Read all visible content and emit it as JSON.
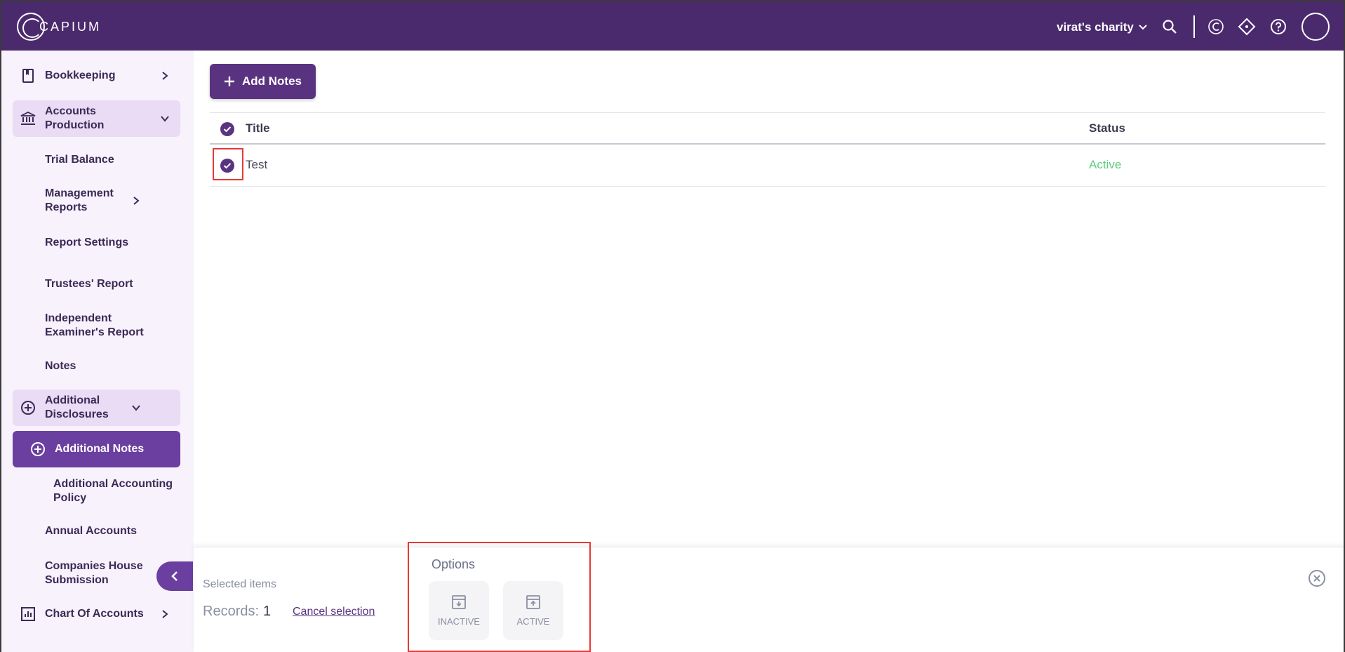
{
  "header": {
    "logo_text": "CAPIUM",
    "org_name": "virat's charity"
  },
  "sidebar": {
    "items": [
      {
        "label": "Bookkeeping",
        "icon": "book-icon"
      },
      {
        "label": "Accounts Production",
        "icon": "bank-icon"
      },
      {
        "label": "Trial Balance"
      },
      {
        "label": "Management Reports"
      },
      {
        "label": "Report Settings"
      },
      {
        "label": "Trustees' Report"
      },
      {
        "label": "Independent Examiner's Report"
      },
      {
        "label": "Notes"
      },
      {
        "label": "Additional Disclosures",
        "icon": "add-circle-icon"
      },
      {
        "label": "Additional Notes",
        "icon": "add-circle-icon"
      },
      {
        "label": "Additional Accounting Policy"
      },
      {
        "label": "Annual Accounts"
      },
      {
        "label": "Companies House Submission"
      },
      {
        "label": "Chart Of Accounts",
        "icon": "chart-icon"
      }
    ]
  },
  "main": {
    "add_button_label": "Add Notes",
    "table": {
      "columns": [
        "Title",
        "Status"
      ],
      "rows": [
        {
          "title": "Test",
          "status": "Active"
        }
      ]
    }
  },
  "selection": {
    "title": "Selected items",
    "records_label": "Records:",
    "records_count": "1",
    "cancel_label": "Cancel selection",
    "options_title": "Options",
    "options": [
      {
        "label": "INACTIVE",
        "icon": "archive-icon"
      },
      {
        "label": "ACTIVE",
        "icon": "unarchive-icon"
      }
    ]
  },
  "colors": {
    "brand": "#4a2a6d",
    "accent": "#6b3fa0",
    "status_active": "#5fcb7e",
    "highlight": "#e53935"
  }
}
